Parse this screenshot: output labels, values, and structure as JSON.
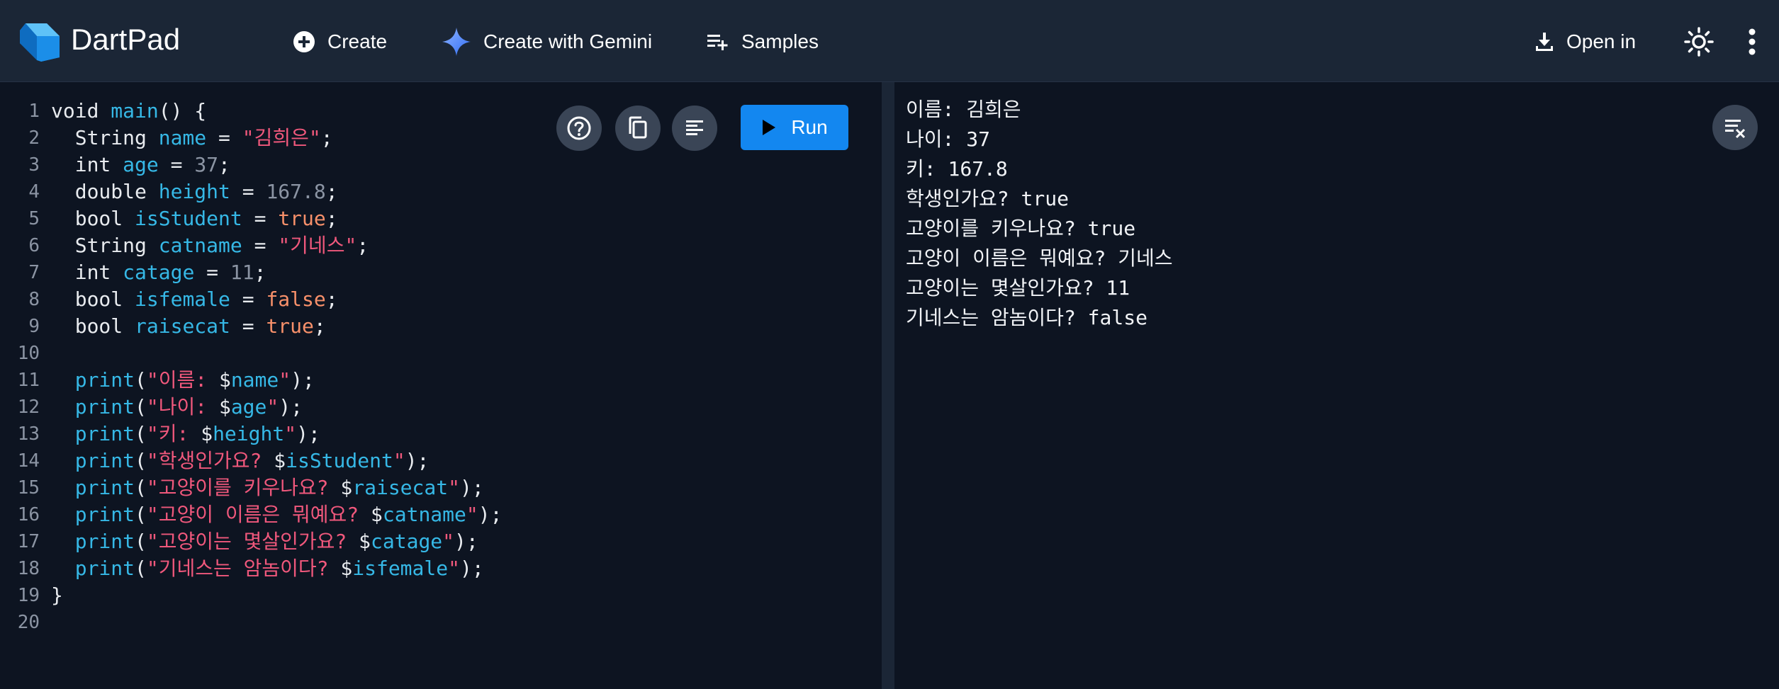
{
  "header": {
    "app_title": "DartPad",
    "nav": [
      {
        "label": "Create",
        "icon": "plus-circle-icon"
      },
      {
        "label": "Create with Gemini",
        "icon": "gemini-sparkle-icon"
      },
      {
        "label": "Samples",
        "icon": "playlist-add-icon"
      }
    ],
    "open_in_label": "Open in",
    "colors": {
      "bar": "#1b2636",
      "accent": "#1387f0"
    }
  },
  "editor": {
    "line_numbers": [
      "1",
      "2",
      "3",
      "4",
      "5",
      "6",
      "7",
      "8",
      "9",
      "10",
      "11",
      "12",
      "13",
      "14",
      "15",
      "16",
      "17",
      "18",
      "19",
      "20"
    ],
    "lines": [
      [
        {
          "t": "void ",
          "c": "kw"
        },
        {
          "t": "main",
          "c": "id"
        },
        {
          "t": "() {",
          "c": "kw"
        }
      ],
      [
        {
          "t": "  String ",
          "c": "kw"
        },
        {
          "t": "name",
          "c": "id"
        },
        {
          "t": " = ",
          "c": "kw"
        },
        {
          "t": "\"김희은\"",
          "c": "str"
        },
        {
          "t": ";",
          "c": "kw"
        }
      ],
      [
        {
          "t": "  int ",
          "c": "kw"
        },
        {
          "t": "age",
          "c": "id"
        },
        {
          "t": " = ",
          "c": "kw"
        },
        {
          "t": "37",
          "c": "num"
        },
        {
          "t": ";",
          "c": "kw"
        }
      ],
      [
        {
          "t": "  double ",
          "c": "kw"
        },
        {
          "t": "height",
          "c": "id"
        },
        {
          "t": " = ",
          "c": "kw"
        },
        {
          "t": "167.8",
          "c": "num"
        },
        {
          "t": ";",
          "c": "kw"
        }
      ],
      [
        {
          "t": "  bool ",
          "c": "kw"
        },
        {
          "t": "isStudent",
          "c": "id"
        },
        {
          "t": " = ",
          "c": "kw"
        },
        {
          "t": "true",
          "c": "bool"
        },
        {
          "t": ";",
          "c": "kw"
        }
      ],
      [
        {
          "t": "  String ",
          "c": "kw"
        },
        {
          "t": "catname",
          "c": "id"
        },
        {
          "t": " = ",
          "c": "kw"
        },
        {
          "t": "\"기네스\"",
          "c": "str"
        },
        {
          "t": ";",
          "c": "kw"
        }
      ],
      [
        {
          "t": "  int ",
          "c": "kw"
        },
        {
          "t": "catage",
          "c": "id"
        },
        {
          "t": " = ",
          "c": "kw"
        },
        {
          "t": "11",
          "c": "num"
        },
        {
          "t": ";",
          "c": "kw"
        }
      ],
      [
        {
          "t": "  bool ",
          "c": "kw"
        },
        {
          "t": "isfemale",
          "c": "id"
        },
        {
          "t": " = ",
          "c": "kw"
        },
        {
          "t": "false",
          "c": "bool"
        },
        {
          "t": ";",
          "c": "kw"
        }
      ],
      [
        {
          "t": "  bool ",
          "c": "kw"
        },
        {
          "t": "raisecat",
          "c": "id"
        },
        {
          "t": " = ",
          "c": "kw"
        },
        {
          "t": "true",
          "c": "bool"
        },
        {
          "t": ";",
          "c": "kw"
        }
      ],
      [
        {
          "t": "",
          "c": "kw"
        }
      ],
      [
        {
          "t": "  ",
          "c": "kw"
        },
        {
          "t": "print",
          "c": "fn"
        },
        {
          "t": "(",
          "c": "kw"
        },
        {
          "t": "\"이름: ",
          "c": "str"
        },
        {
          "t": "$",
          "c": "kw"
        },
        {
          "t": "name",
          "c": "id"
        },
        {
          "t": "\"",
          "c": "str"
        },
        {
          "t": ");",
          "c": "kw"
        }
      ],
      [
        {
          "t": "  ",
          "c": "kw"
        },
        {
          "t": "print",
          "c": "fn"
        },
        {
          "t": "(",
          "c": "kw"
        },
        {
          "t": "\"나이: ",
          "c": "str"
        },
        {
          "t": "$",
          "c": "kw"
        },
        {
          "t": "age",
          "c": "id"
        },
        {
          "t": "\"",
          "c": "str"
        },
        {
          "t": ");",
          "c": "kw"
        }
      ],
      [
        {
          "t": "  ",
          "c": "kw"
        },
        {
          "t": "print",
          "c": "fn"
        },
        {
          "t": "(",
          "c": "kw"
        },
        {
          "t": "\"키: ",
          "c": "str"
        },
        {
          "t": "$",
          "c": "kw"
        },
        {
          "t": "height",
          "c": "id"
        },
        {
          "t": "\"",
          "c": "str"
        },
        {
          "t": ");",
          "c": "kw"
        }
      ],
      [
        {
          "t": "  ",
          "c": "kw"
        },
        {
          "t": "print",
          "c": "fn"
        },
        {
          "t": "(",
          "c": "kw"
        },
        {
          "t": "\"학생인가요? ",
          "c": "str"
        },
        {
          "t": "$",
          "c": "kw"
        },
        {
          "t": "isStudent",
          "c": "id"
        },
        {
          "t": "\"",
          "c": "str"
        },
        {
          "t": ");",
          "c": "kw"
        }
      ],
      [
        {
          "t": "  ",
          "c": "kw"
        },
        {
          "t": "print",
          "c": "fn"
        },
        {
          "t": "(",
          "c": "kw"
        },
        {
          "t": "\"고양이를 키우나요? ",
          "c": "str"
        },
        {
          "t": "$",
          "c": "kw"
        },
        {
          "t": "raisecat",
          "c": "id"
        },
        {
          "t": "\"",
          "c": "str"
        },
        {
          "t": ");",
          "c": "kw"
        }
      ],
      [
        {
          "t": "  ",
          "c": "kw"
        },
        {
          "t": "print",
          "c": "fn"
        },
        {
          "t": "(",
          "c": "kw"
        },
        {
          "t": "\"고양이 이름은 뭐예요? ",
          "c": "str"
        },
        {
          "t": "$",
          "c": "kw"
        },
        {
          "t": "catname",
          "c": "id"
        },
        {
          "t": "\"",
          "c": "str"
        },
        {
          "t": ");",
          "c": "kw"
        }
      ],
      [
        {
          "t": "  ",
          "c": "kw"
        },
        {
          "t": "print",
          "c": "fn"
        },
        {
          "t": "(",
          "c": "kw"
        },
        {
          "t": "\"고양이는 몇살인가요? ",
          "c": "str"
        },
        {
          "t": "$",
          "c": "kw"
        },
        {
          "t": "catage",
          "c": "id"
        },
        {
          "t": "\"",
          "c": "str"
        },
        {
          "t": ");",
          "c": "kw"
        }
      ],
      [
        {
          "t": "  ",
          "c": "kw"
        },
        {
          "t": "print",
          "c": "fn"
        },
        {
          "t": "(",
          "c": "kw"
        },
        {
          "t": "\"기네스는 암놈이다? ",
          "c": "str"
        },
        {
          "t": "$",
          "c": "kw"
        },
        {
          "t": "isfemale",
          "c": "id"
        },
        {
          "t": "\"",
          "c": "str"
        },
        {
          "t": ");",
          "c": "kw"
        }
      ],
      [
        {
          "t": "}",
          "c": "kw"
        }
      ],
      [
        {
          "t": "",
          "c": "kw"
        }
      ]
    ],
    "run_label": "Run",
    "tools": [
      "help-icon",
      "copy-icon",
      "format-icon"
    ]
  },
  "console": {
    "lines": [
      "이름: 김희은",
      "나이: 37",
      "키: 167.8",
      "학생인가요? true",
      "고양이를 키우나요? true",
      "고양이 이름은 뭐예요? 기네스",
      "고양이는 몇살인가요? 11",
      "기네스는 암놈이다? false"
    ]
  }
}
